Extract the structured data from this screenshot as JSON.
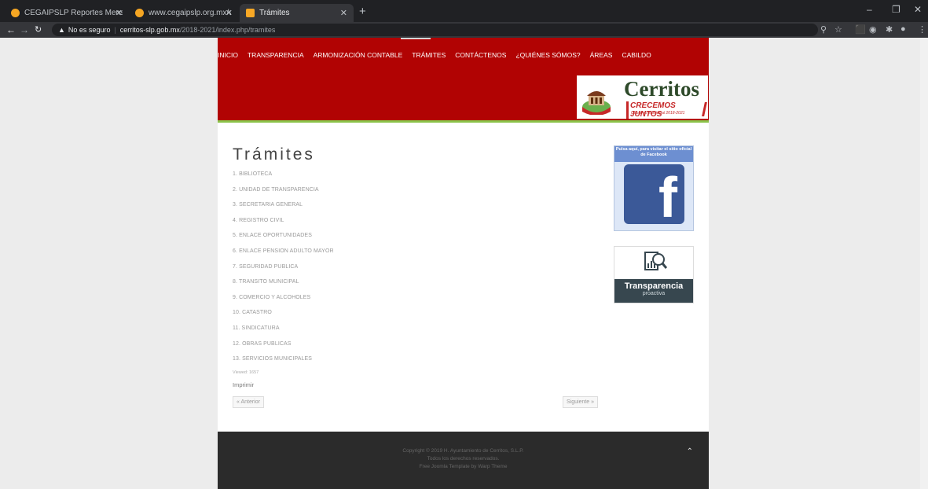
{
  "browser": {
    "tabs": [
      {
        "label": "CEGAIPSLP Reportes Mensuales",
        "favicon_color": "#f5a623"
      },
      {
        "label": "www.cegaipslp.org.mx/webcega",
        "favicon_color": "#f5a623"
      },
      {
        "label": "Trámites",
        "favicon_color": "#f9a825"
      }
    ],
    "new_tab": "+",
    "window_controls": {
      "minimize": "–",
      "restore": "❐",
      "close": "✕"
    },
    "security_label": "No es seguro",
    "url_domain": "cerritos-slp.gob.mx",
    "url_path": "/2018-2021/index.php/tramites"
  },
  "site": {
    "menu": [
      "INICIO",
      "TRANSPARENCIA",
      "ARMONIZACIÓN CONTABLE",
      "TRÁMITES",
      "CONTÁCTENOS",
      "¿QUIÉNES SÓMOS?",
      "ÁREAS",
      "CABILDO"
    ],
    "logo": {
      "brand": "Cerritos",
      "slogan": "CRECEMOS JUNTOS",
      "subtitle": "Gobierno Municipal 2018-2021"
    },
    "colors": {
      "header": "#b10303",
      "accent": "#8bc34a",
      "footer": "#2b2b2b"
    }
  },
  "content": {
    "title": "Trámites",
    "items": [
      "1. BIBLIOTECA",
      "2. UNIDAD DE TRANSPARENCIA",
      "3. SECRETARIA GENERAL",
      "4. REGISTRO CIVIL",
      "5. ENLACE OPORTUNIDADES",
      "6. ENLACE PENSION ADULTO MAYOR",
      "7. SEGURIDAD PUBLICA",
      "8. TRANSITO MUNICIPAL",
      "9. COMERCIO Y ALCOHOLES",
      "10. CATASTRO",
      "11. SINDICATURA",
      "12. OBRAS PUBLICAS",
      "13. SERVICIOS MUNICIPALES"
    ],
    "viewed": "Viewed: 1657",
    "print": "Imprimir",
    "prev": "« Anterior",
    "next": "Siguiente »"
  },
  "sidebar": {
    "facebook_text": "Pulsa aquí, para visitar el sitio oficial de Facebook",
    "transparencia_title": "Transparencia",
    "transparencia_sub": "proactiva"
  },
  "footer": {
    "copyright": "Copyright © 2019 H. Ayuntamiento de Cerritos, S.L.P.",
    "rights": "Todos los derechos reservados.",
    "credit": "Free Joomla Template by Warp Theme",
    "totop": "⌃"
  }
}
